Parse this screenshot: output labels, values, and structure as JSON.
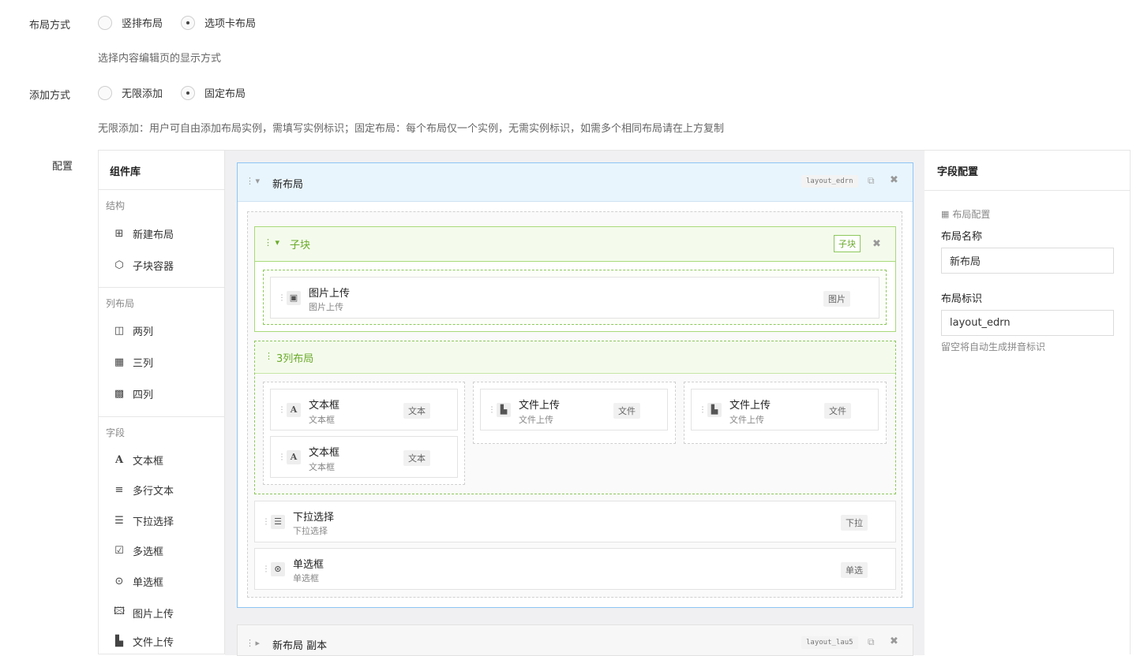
{
  "layout_mode": {
    "label": "布局方式",
    "options": [
      {
        "label": "竖排布局",
        "selected": false
      },
      {
        "label": "选项卡布局",
        "selected": true
      }
    ],
    "hint": "选择内容编辑页的显示方式"
  },
  "add_mode": {
    "label": "添加方式",
    "options": [
      {
        "label": "无限添加",
        "selected": false
      },
      {
        "label": "固定布局",
        "selected": true
      }
    ],
    "hint": "无限添加：用户可自由添加布局实例，需填写实例标识；固定布局：每个布局仅一个实例，无需实例标识，如需多个相同布局请在上方复制"
  },
  "config_label": "配置",
  "library": {
    "title": "组件库",
    "sections": [
      {
        "title": "结构",
        "items": [
          {
            "label": "新建布局",
            "icon": "plus-square-icon"
          },
          {
            "label": "子块容器",
            "icon": "cube-icon"
          }
        ]
      },
      {
        "title": "列布局",
        "items": [
          {
            "label": "两列",
            "icon": "columns-icon"
          },
          {
            "label": "三列",
            "icon": "grid-icon"
          },
          {
            "label": "四列",
            "icon": "grid-9-icon"
          }
        ]
      },
      {
        "title": "字段",
        "items": [
          {
            "label": "文本框",
            "icon": "font-icon"
          },
          {
            "label": "多行文本",
            "icon": "align-left-icon"
          },
          {
            "label": "下拉选择",
            "icon": "list-icon"
          },
          {
            "label": "多选框",
            "icon": "checkbox-icon"
          },
          {
            "label": "单选框",
            "icon": "radio-icon"
          },
          {
            "label": "图片上传",
            "icon": "image-icon"
          },
          {
            "label": "文件上传",
            "icon": "file-icon"
          }
        ]
      }
    ]
  },
  "canvas": {
    "layout": {
      "title": "新布局",
      "code": "layout_edrn"
    },
    "subblock": {
      "title": "子块",
      "tag": "子块",
      "field": {
        "title": "图片上传",
        "sub": "图片上传",
        "tag": "图片"
      }
    },
    "cols3": {
      "title": "3列布局",
      "col1": [
        {
          "title": "文本框",
          "sub": "文本框",
          "tag": "文本"
        },
        {
          "title": "文本框",
          "sub": "文本框",
          "tag": "文本"
        }
      ],
      "col2": [
        {
          "title": "文件上传",
          "sub": "文件上传",
          "tag": "文件"
        }
      ],
      "col3": [
        {
          "title": "文件上传",
          "sub": "文件上传",
          "tag": "文件"
        }
      ]
    },
    "select_field": {
      "title": "下拉选择",
      "sub": "下拉选择",
      "tag": "下拉"
    },
    "radio_field": {
      "title": "单选框",
      "sub": "单选框",
      "tag": "单选"
    },
    "layout2": {
      "title": "新布局 副本",
      "code": "layout_lau5"
    }
  },
  "field_config": {
    "title": "字段配置",
    "section": "布局配置",
    "name_label": "布局名称",
    "name_value": "新布局",
    "id_label": "布局标识",
    "id_value": "layout_edrn",
    "id_hint": "留空将自动生成拼音标识"
  }
}
